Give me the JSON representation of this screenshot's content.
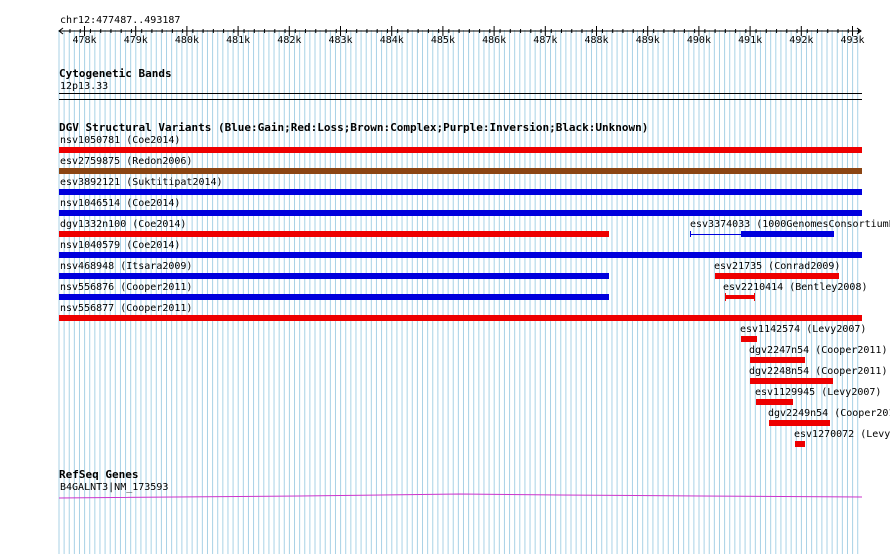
{
  "colors": {
    "gain": "#0000dd",
    "loss": "#ee0000",
    "complex": "#8b4513",
    "refseq": "#cc33cc",
    "grid": "#a8d2e6"
  },
  "ruler": {
    "position": "chr12:477487..493187",
    "ticks": [
      "478k",
      "479k",
      "480k",
      "481k",
      "482k",
      "483k",
      "484k",
      "485k",
      "486k",
      "487k",
      "488k",
      "489k",
      "490k",
      "491k",
      "492k",
      "493k"
    ]
  },
  "tracks": {
    "cytoband": {
      "title": "Cytogenetic Bands",
      "band": "12p13.33"
    },
    "dgv": {
      "title": "DGV Structural Variants (Blue:Gain;Red:Loss;Brown:Complex;Purple:Inversion;Black:Unknown)",
      "features": [
        {
          "label": "nsv1050781 (Coe2014)",
          "type": "loss"
        },
        {
          "label": "esv2759875 (Redon2006)",
          "type": "complex"
        },
        {
          "label": "esv3892121 (Suktitipat2014)",
          "type": "gain"
        },
        {
          "label": "nsv1046514 (Coe2014)",
          "type": "gain"
        },
        {
          "label": "dgv1332n100 (Coe2014)",
          "type": "loss"
        },
        {
          "label": "nsv1040579 (Coe2014)",
          "type": "gain"
        },
        {
          "label": "nsv468948 (Itsara2009)",
          "type": "gain"
        },
        {
          "label": "nsv556876 (Cooper2011)",
          "type": "gain"
        },
        {
          "label": "nsv556877 (Cooper2011)",
          "type": "loss"
        },
        {
          "label": "esv3374033 (1000GenomesConsortiumP",
          "type": "gain"
        },
        {
          "label": "esv21735 (Conrad2009)",
          "type": "loss"
        },
        {
          "label": "esv2210414 (Bentley2008)",
          "type": "loss"
        },
        {
          "label": "esv1142574 (Levy2007)",
          "type": "loss"
        },
        {
          "label": "dgv2247n54 (Cooper2011)",
          "type": "loss"
        },
        {
          "label": "dgv2248n54 (Cooper2011)",
          "type": "loss"
        },
        {
          "label": "esv1129945 (Levy2007)",
          "type": "loss"
        },
        {
          "label": "dgv2249n54 (Cooper201",
          "type": "loss"
        },
        {
          "label": "esv1270072 (Levy",
          "type": "loss"
        }
      ]
    },
    "refseq": {
      "title": "RefSeq Genes",
      "gene": "B4GALNT3|NM_173593"
    }
  }
}
